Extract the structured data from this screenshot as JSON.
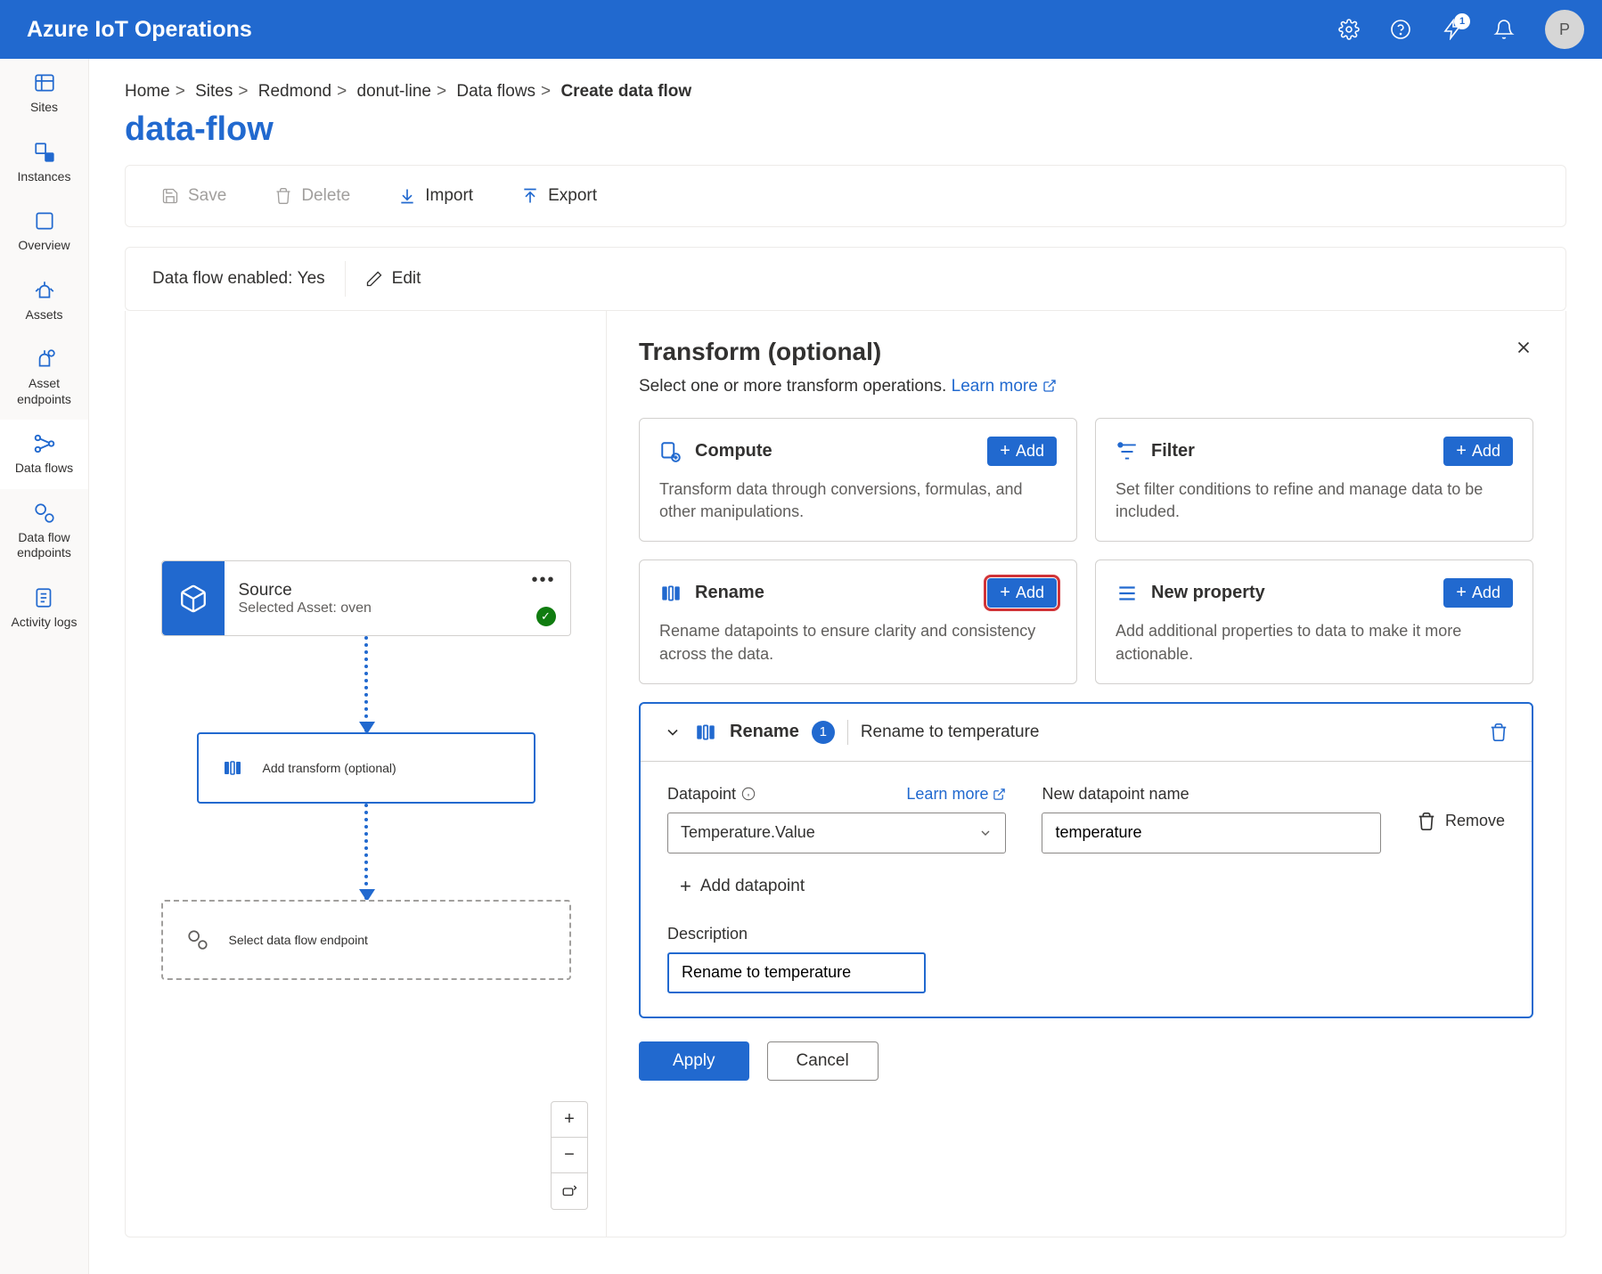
{
  "app": {
    "title": "Azure IoT Operations"
  },
  "topbar": {
    "notifications": "1",
    "avatar_initial": "P"
  },
  "sidebar": [
    {
      "label": "Sites"
    },
    {
      "label": "Instances"
    },
    {
      "label": "Overview"
    },
    {
      "label": "Assets"
    },
    {
      "label": "Asset endpoints"
    },
    {
      "label": "Data flows"
    },
    {
      "label": "Data flow endpoints"
    },
    {
      "label": "Activity logs"
    }
  ],
  "breadcrumbs": {
    "items": [
      "Home",
      "Sites",
      "Redmond",
      "donut-line",
      "Data flows"
    ],
    "current": "Create data flow"
  },
  "page": {
    "title": "data-flow"
  },
  "commands": {
    "save": "Save",
    "delete": "Delete",
    "import": "Import",
    "export": "Export"
  },
  "status": {
    "label": "Data flow enabled:",
    "value": "Yes",
    "edit": "Edit"
  },
  "canvas": {
    "source": {
      "title": "Source",
      "subtitle": "Selected Asset: oven"
    },
    "transform": {
      "label": "Add transform (optional)"
    },
    "endpoint": {
      "label": "Select data flow endpoint"
    }
  },
  "panel": {
    "title": "Transform (optional)",
    "subtitle": "Select one or more transform operations.",
    "learn_more": "Learn more",
    "add": "Add",
    "ops": {
      "compute": {
        "title": "Compute",
        "desc": "Transform data through conversions, formulas, and other manipulations."
      },
      "filter": {
        "title": "Filter",
        "desc": "Set filter conditions to refine and manage data to be included."
      },
      "rename": {
        "title": "Rename",
        "desc": "Rename datapoints to ensure clarity and consistency across the data."
      },
      "newprop": {
        "title": "New property",
        "desc": "Add additional properties to data to make it more actionable."
      }
    },
    "config": {
      "title": "Rename",
      "count": "1",
      "subtitle": "Rename to temperature",
      "datapoint_label": "Datapoint",
      "learn_more": "Learn more",
      "newname_label": "New datapoint name",
      "remove": "Remove",
      "datapoint_value": "Temperature.Value",
      "newname_value": "temperature",
      "add_datapoint": "Add datapoint",
      "description_label": "Description",
      "description_value": "Rename to temperature"
    },
    "footer": {
      "apply": "Apply",
      "cancel": "Cancel"
    }
  }
}
